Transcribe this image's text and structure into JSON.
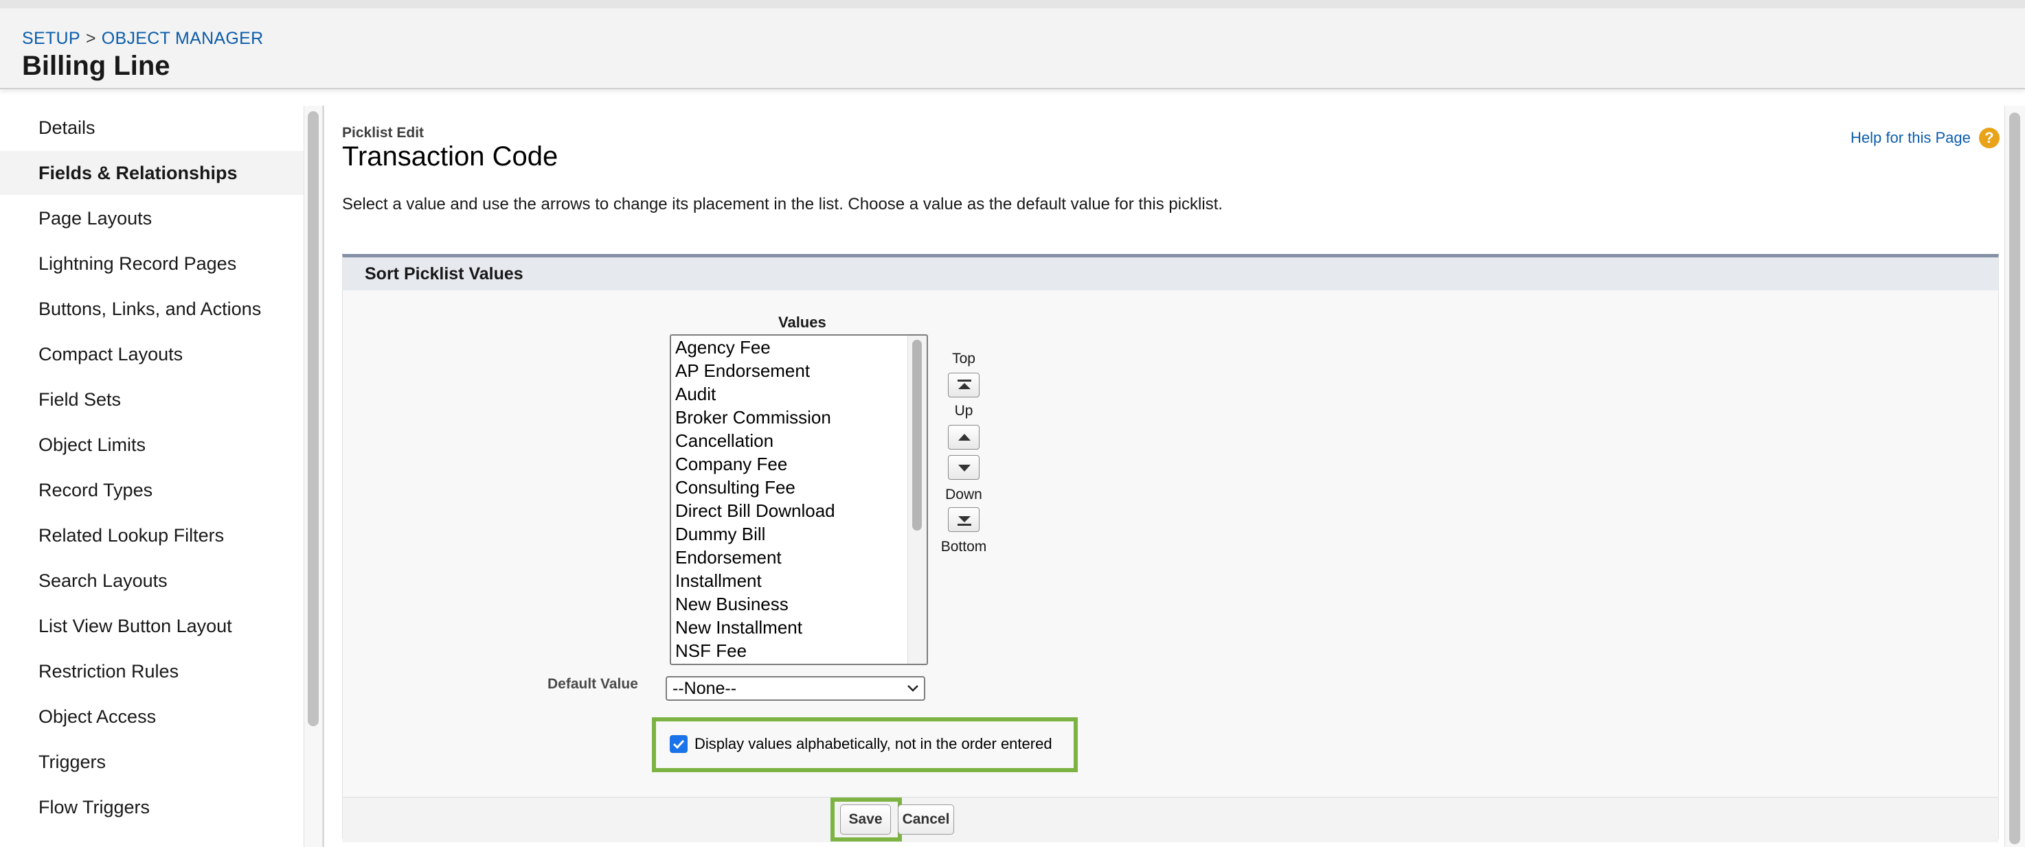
{
  "header": {
    "breadcrumb": [
      "SETUP",
      "OBJECT MANAGER"
    ],
    "breadcrumb_separator": ">",
    "title": "Billing Line"
  },
  "sidebar": {
    "items": [
      {
        "label": "Details",
        "active": false
      },
      {
        "label": "Fields & Relationships",
        "active": true
      },
      {
        "label": "Page Layouts",
        "active": false
      },
      {
        "label": "Lightning Record Pages",
        "active": false
      },
      {
        "label": "Buttons, Links, and Actions",
        "active": false
      },
      {
        "label": "Compact Layouts",
        "active": false
      },
      {
        "label": "Field Sets",
        "active": false
      },
      {
        "label": "Object Limits",
        "active": false
      },
      {
        "label": "Record Types",
        "active": false
      },
      {
        "label": "Related Lookup Filters",
        "active": false
      },
      {
        "label": "Search Layouts",
        "active": false
      },
      {
        "label": "List View Button Layout",
        "active": false
      },
      {
        "label": "Restriction Rules",
        "active": false
      },
      {
        "label": "Object Access",
        "active": false
      },
      {
        "label": "Triggers",
        "active": false
      },
      {
        "label": "Flow Triggers",
        "active": false
      }
    ]
  },
  "main": {
    "edit_label": "Picklist Edit",
    "title": "Transaction Code",
    "help_link": "Help for this Page",
    "help_icon": "?",
    "instructions": "Select a value and use the arrows to change its placement in the list. Choose a value as the default value for this picklist."
  },
  "section": {
    "title": "Sort Picklist Values",
    "values_label": "Values",
    "values": [
      "Agency Fee",
      "AP Endorsement",
      "Audit",
      "Broker Commission",
      "Cancellation",
      "Company Fee",
      "Consulting Fee",
      "Direct Bill Download",
      "Dummy Bill",
      "Endorsement",
      "Installment",
      "New Business",
      "New Installment",
      "NSF Fee"
    ],
    "arrows": {
      "top": "Top",
      "up": "Up",
      "down": "Down",
      "bottom": "Bottom"
    },
    "default_value_label": "Default Value",
    "default_value": "--None--",
    "alphabetical_checkbox": {
      "label": "Display values alphabetically, not in the order entered",
      "checked": true
    },
    "buttons": {
      "save": "Save",
      "cancel": "Cancel"
    }
  },
  "colors": {
    "link": "#0b5cab",
    "highlight": "#7cb342",
    "checkbox": "#1a73e8",
    "section_border": "#8390a6",
    "help_icon": "#e8a319"
  }
}
